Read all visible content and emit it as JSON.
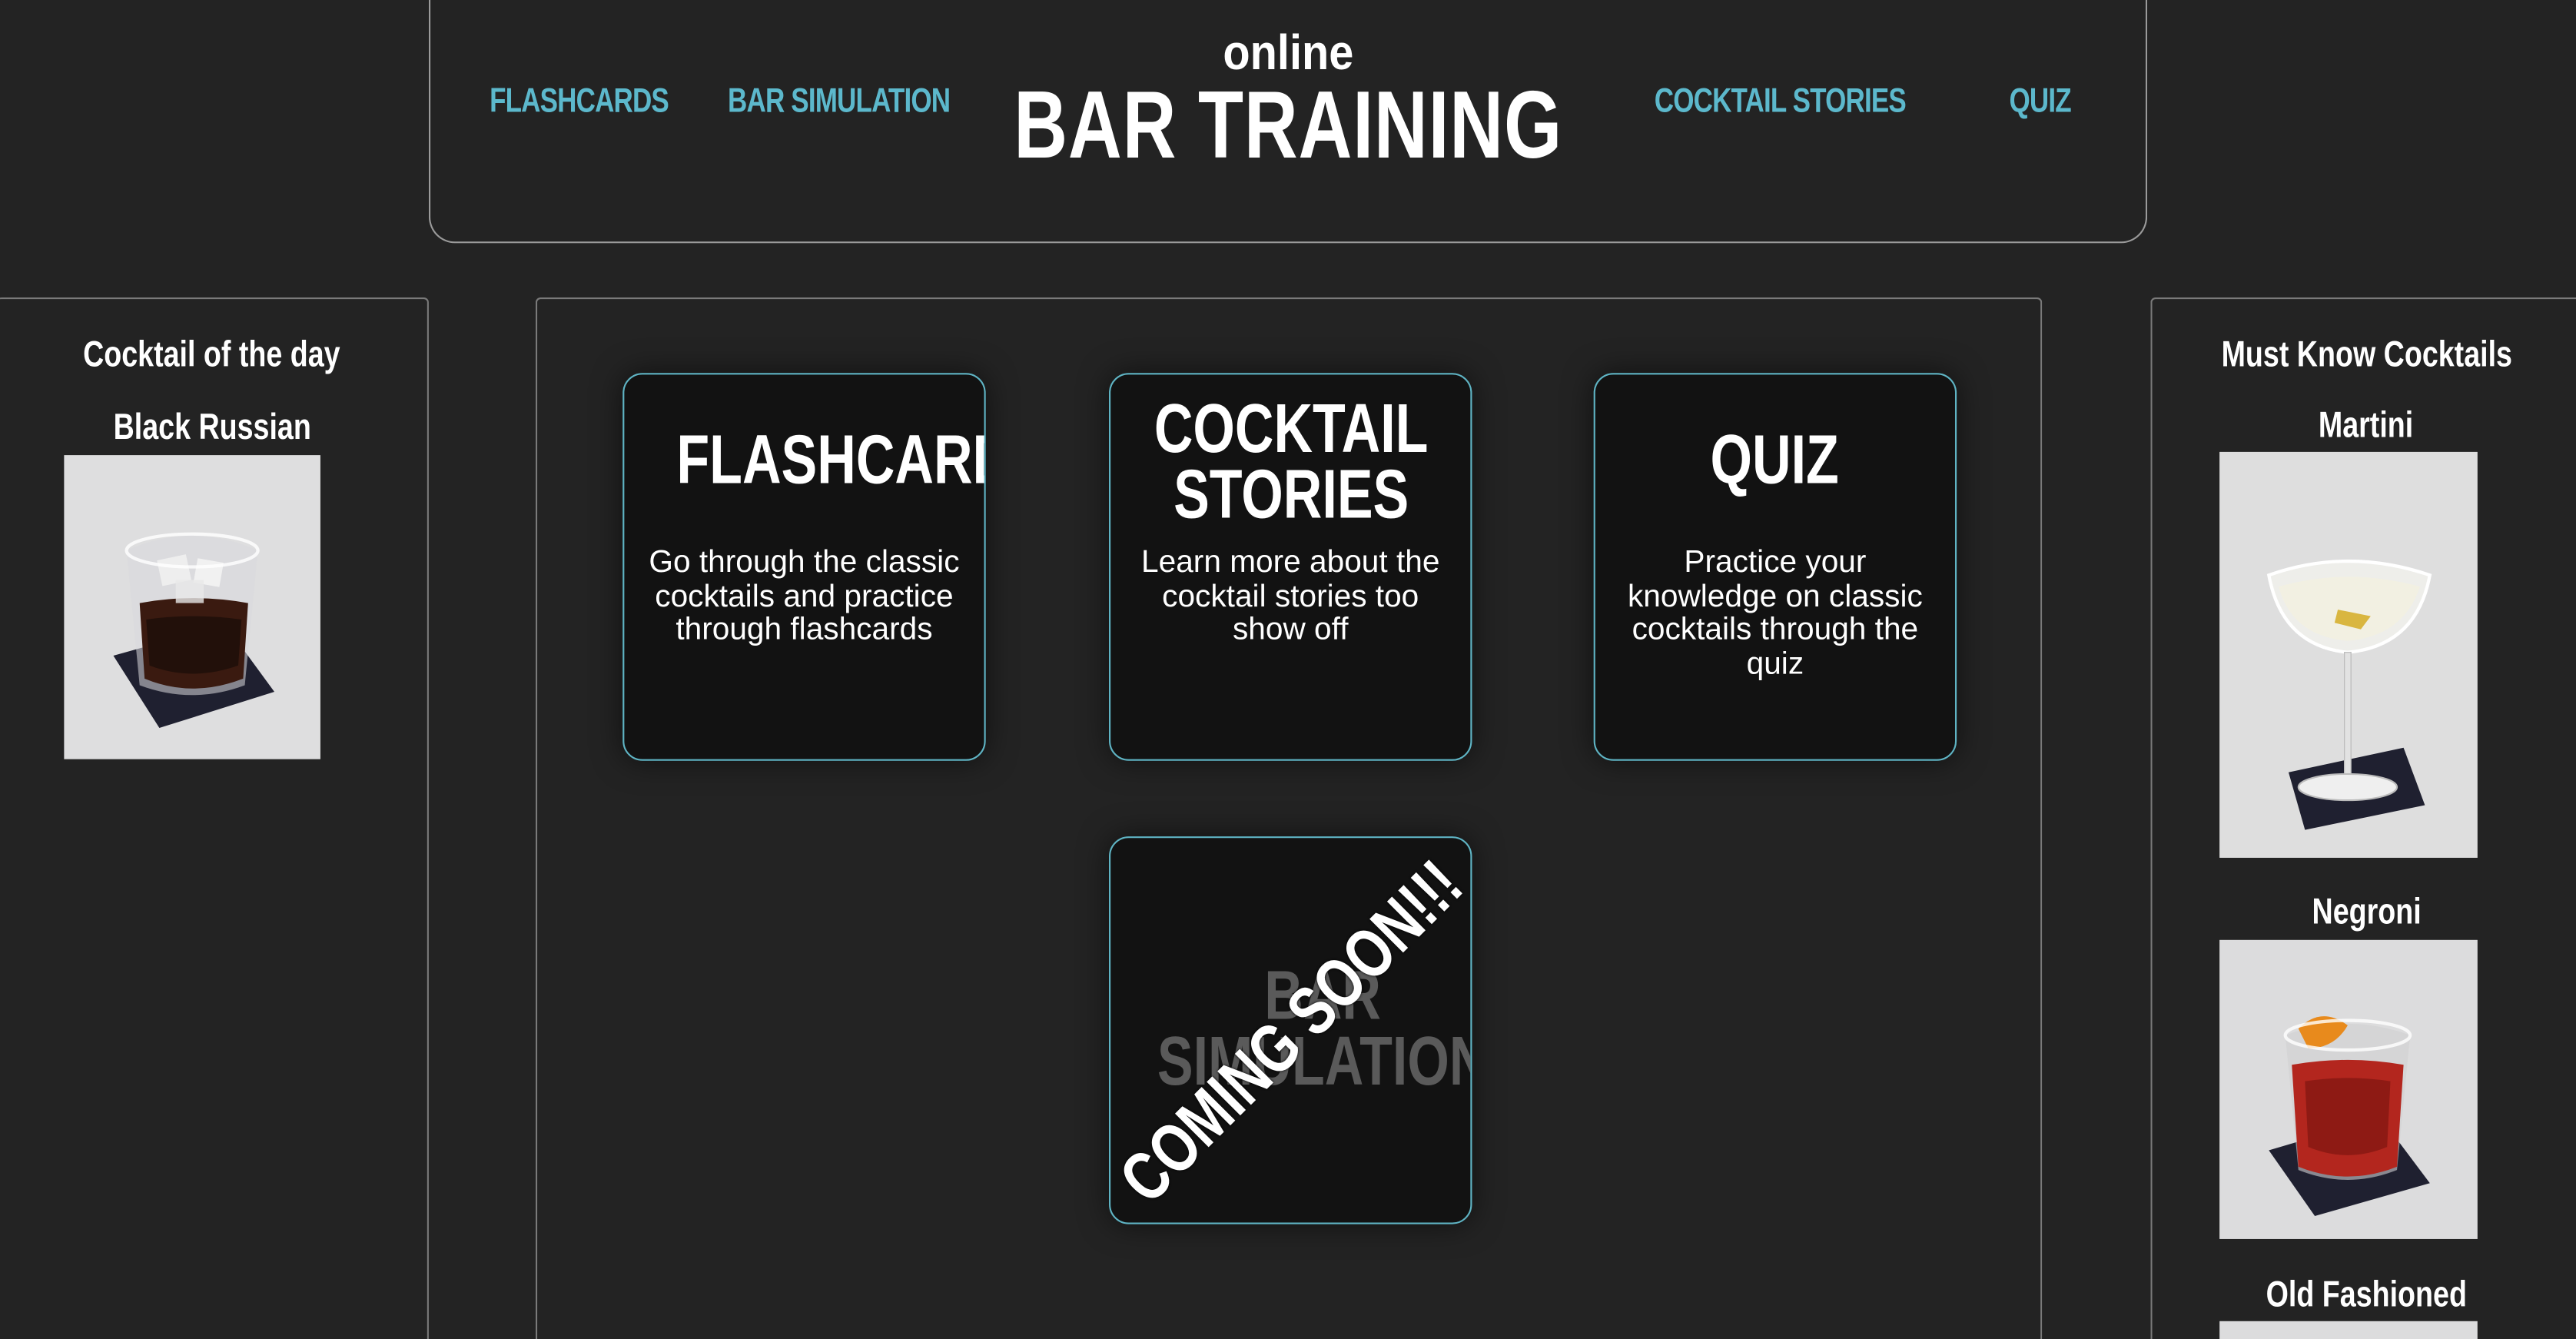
{
  "header": {
    "brand_small": "online",
    "brand_big": "BAR TRAINING",
    "nav": {
      "flashcards": "FLASHCARDS",
      "bar_simulation": "BAR SIMULATION",
      "cocktail_stories": "COCKTAIL STORIES",
      "quiz": "QUIZ"
    }
  },
  "left_panel": {
    "title": "Cocktail of the day",
    "cocktail_name": "Black Russian"
  },
  "right_panel": {
    "title": "Must Know Cocktails",
    "cocktails": [
      "Martini",
      "Negroni",
      "Old Fashioned"
    ]
  },
  "cards": {
    "flashcards": {
      "title": "FLASHCARDS",
      "text": "Go through the classic cocktails and practice through flashcards"
    },
    "stories": {
      "title": "COCKTAIL\nSTORIES",
      "text": "Learn more about the cocktail stories too show off"
    },
    "quiz": {
      "title": "QUIZ",
      "text": "Practice your knowledge on classic cocktails through the quiz"
    },
    "simulation": {
      "title": "BAR\nSIMULATION",
      "ribbon": "COMING SOON!!!"
    }
  },
  "colors": {
    "background": "#232323",
    "accent": "#5cb8cc",
    "card_bg": "#121212"
  }
}
